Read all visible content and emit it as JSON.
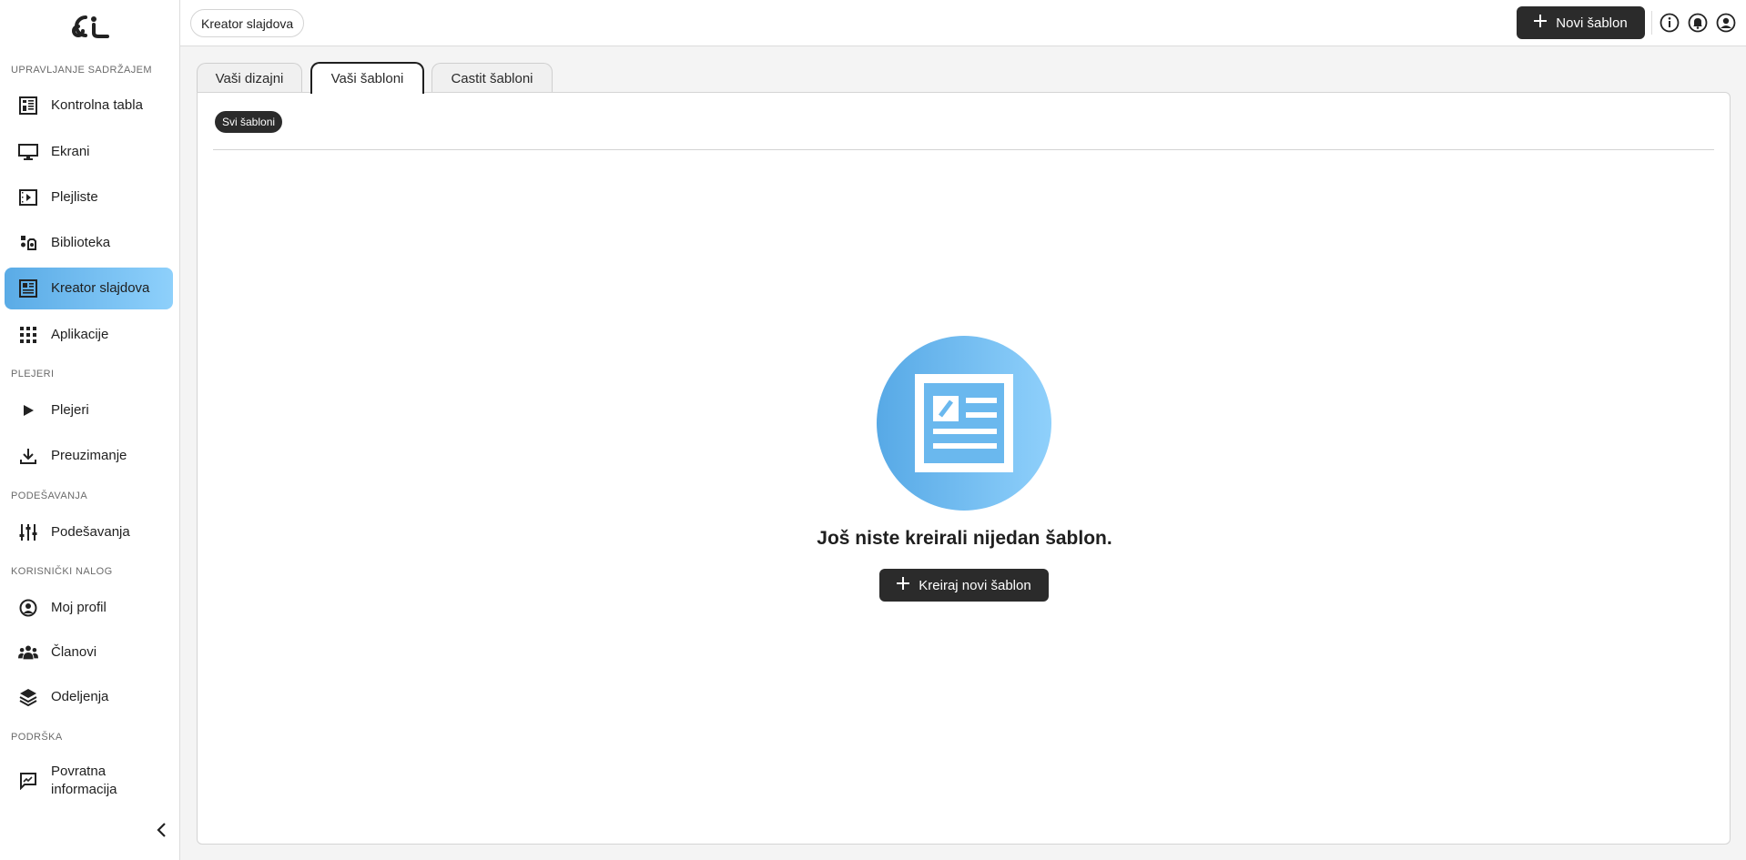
{
  "sidebar": {
    "sections": [
      {
        "label": "UPRAVLJANJE SADRŽAJEM"
      },
      {
        "label": "PLEJERI"
      },
      {
        "label": "PODEŠAVANJA"
      },
      {
        "label": "KORISNIČKI NALOG"
      },
      {
        "label": "PODRŠKA"
      }
    ],
    "items": [
      {
        "label": "Kontrolna tabla",
        "icon": "dashboard-icon"
      },
      {
        "label": "Ekrani",
        "icon": "monitor-icon"
      },
      {
        "label": "Plejliste",
        "icon": "playlist-icon"
      },
      {
        "label": "Biblioteka",
        "icon": "media-library-icon"
      },
      {
        "label": "Kreator slajdova",
        "icon": "slide-creator-icon",
        "active": true
      },
      {
        "label": "Aplikacije",
        "icon": "apps-grid-icon"
      },
      {
        "label": "Plejeri",
        "icon": "play-icon"
      },
      {
        "label": "Preuzimanje",
        "icon": "download-icon"
      },
      {
        "label": "Podešavanja",
        "icon": "sliders-icon"
      },
      {
        "label": "Moj profil",
        "icon": "user-circle-icon"
      },
      {
        "label": "Članovi",
        "icon": "group-icon"
      },
      {
        "label": "Odeljenja",
        "icon": "layers-icon"
      },
      {
        "label": "Povratna informacija",
        "icon": "feedback-icon"
      }
    ]
  },
  "topbar": {
    "breadcrumb": "Kreator slajdova",
    "new_button": "Novi šablon"
  },
  "tabs": [
    {
      "label": "Vaši dizajni"
    },
    {
      "label": "Vaši šabloni",
      "active": true
    },
    {
      "label": "Castit šabloni"
    }
  ],
  "filter_chip": "Svi šabloni",
  "empty_state": {
    "message": "Još niste kreirali nijedan šablon.",
    "button": "Kreiraj novi šablon"
  },
  "colors": {
    "accent_start": "#5aabe6",
    "accent_end": "#8ed0fb",
    "dark_button": "#2b2b2b"
  }
}
